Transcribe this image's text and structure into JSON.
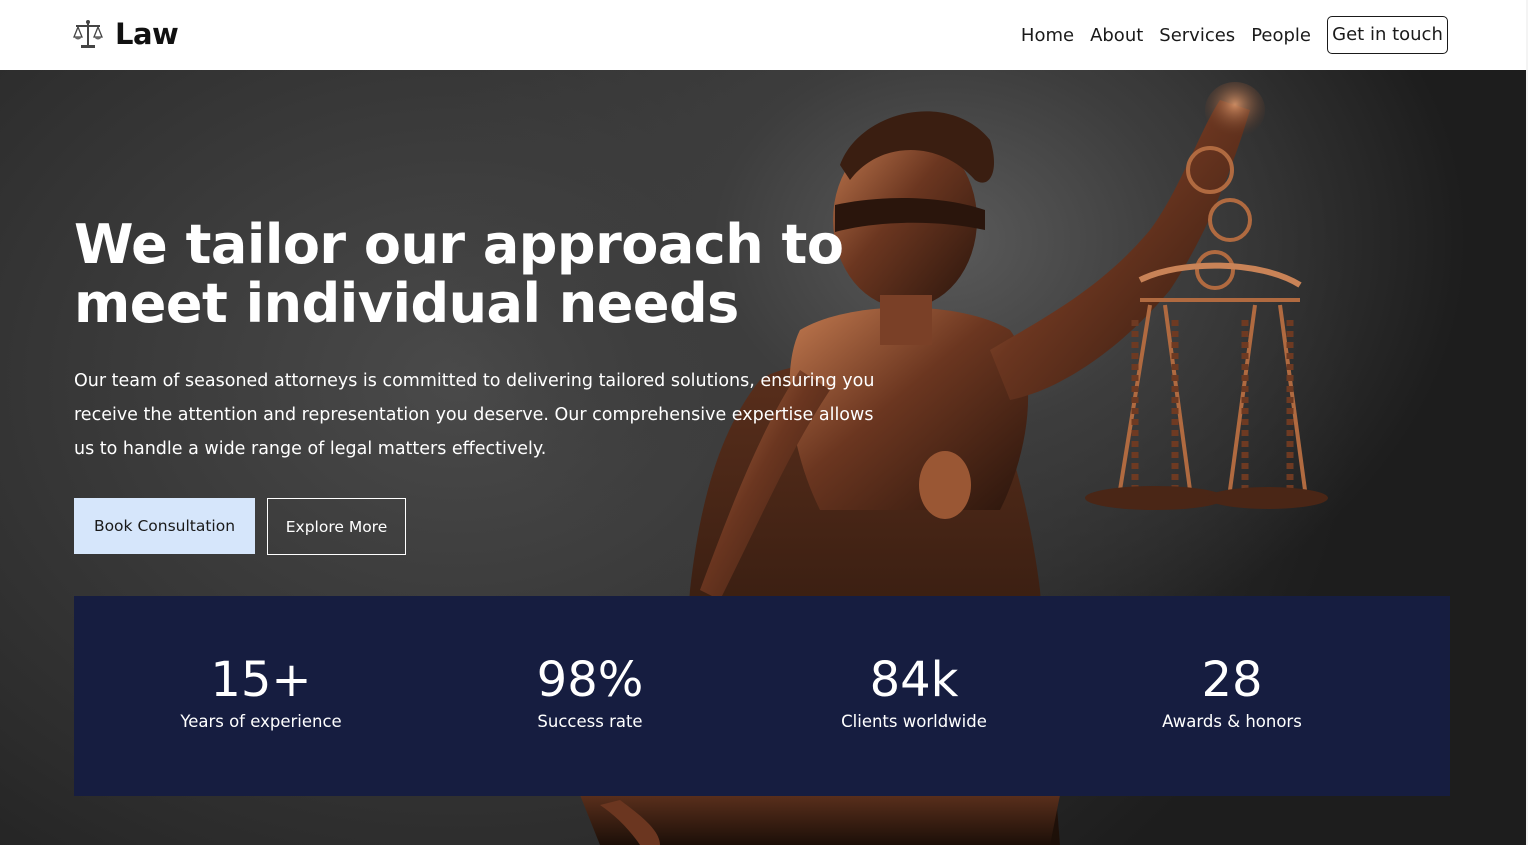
{
  "brand": {
    "name": "Law",
    "icon": "scales-of-justice-icon"
  },
  "nav": {
    "items": [
      {
        "label": "Home"
      },
      {
        "label": "About"
      },
      {
        "label": "Services"
      },
      {
        "label": "People"
      }
    ],
    "cta_label": "Get in touch"
  },
  "hero": {
    "title_line1": "We tailor our approach to",
    "title_line2": "meet individual needs",
    "description": "Our team of seasoned attorneys is committed to delivering tailored solutions, ensuring you receive the attention and representation you deserve. Our comprehensive expertise allows us to handle a wide range of legal matters effectively.",
    "primary_button": "Book Consultation",
    "secondary_button": "Explore More"
  },
  "stats": [
    {
      "value": "15+",
      "label": "Years of experience"
    },
    {
      "value": "98%",
      "label": "Success rate"
    },
    {
      "value": "84k",
      "label": "Clients worldwide"
    },
    {
      "value": "28",
      "label": "Awards & honors"
    }
  ],
  "colors": {
    "header_bg": "#ffffff",
    "stats_bg": "#161d40",
    "primary_button_bg": "#d6e6fb",
    "hero_bg": "#2b2b2b",
    "statue_bronze": "#8a4a2c"
  }
}
